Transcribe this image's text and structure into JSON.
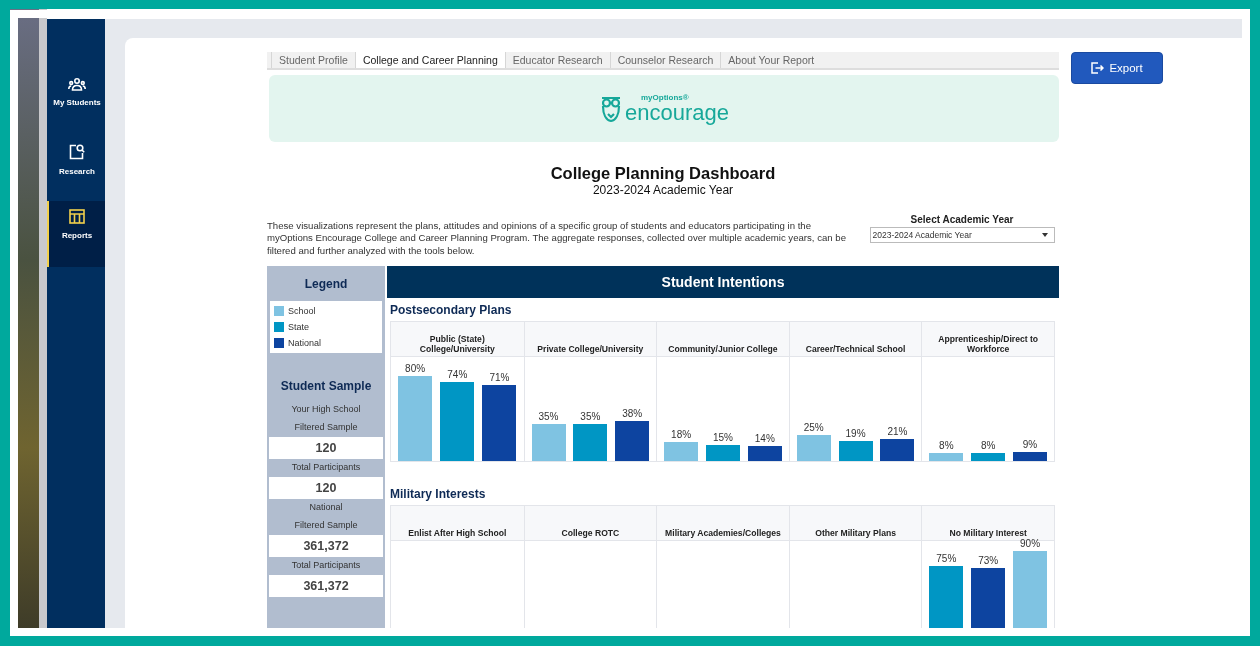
{
  "sidebar": {
    "items": [
      {
        "label": "My Students",
        "selected": false
      },
      {
        "label": "Research",
        "selected": false
      },
      {
        "label": "Reports",
        "selected": true
      }
    ]
  },
  "tabs": [
    {
      "label": "Student Profile",
      "selected": false
    },
    {
      "label": "College and Career Planning",
      "selected": true
    },
    {
      "label": "Educator Research",
      "selected": false
    },
    {
      "label": "Counselor Research",
      "selected": false
    },
    {
      "label": "About Your Report",
      "selected": false
    }
  ],
  "logo": {
    "superscript": "myOptions®",
    "wordmark": "encourage"
  },
  "export_button": {
    "label": "Export"
  },
  "title": "College Planning Dashboard",
  "subtitle": "2023-2024 Academic Year",
  "description": "These visualizations represent the plans, attitudes and opinions of a specific group of students and educators participating in the myOptions Encourage College and Career Planning Program. The aggregate responses, collected over multiple academic years, can be filtered and further analyzed with the tools below.",
  "year_select": {
    "label": "Select Academic Year",
    "value": "2023-2024 Academic Year"
  },
  "legend": {
    "title": "Legend",
    "items": [
      {
        "label": "School",
        "color": "#7fc3e2"
      },
      {
        "label": "State",
        "color": "#0096c4"
      },
      {
        "label": "National",
        "color": "#0d44a0"
      }
    ]
  },
  "student_sample": {
    "title": "Student Sample",
    "groups": [
      {
        "heading": "Your High School",
        "fields": [
          {
            "label": "Filtered Sample",
            "value": "120"
          },
          {
            "label": "Total Participants",
            "value": "120"
          }
        ]
      },
      {
        "heading": "National",
        "fields": [
          {
            "label": "Filtered Sample",
            "value": "361,372"
          },
          {
            "label": "Total Participants",
            "value": "361,372"
          }
        ]
      }
    ]
  },
  "panel_title": "Student Intentions",
  "sections": [
    {
      "title": "Postsecondary Plans",
      "chart_data": {
        "type": "bar",
        "categories": [
          "Public (State) College/University",
          "Private College/University",
          "Community/Junior College",
          "Career/Technical School",
          "Apprenticeship/Direct to Workforce"
        ],
        "series": [
          {
            "color": "#7fc3e2",
            "values": [
              80,
              35,
              18,
              25,
              8
            ],
            "value_labels": [
              "80%",
              "35%",
              "18%",
              "25%",
              "8%"
            ]
          },
          {
            "color": "#0096c4",
            "values": [
              74,
              35,
              15,
              19,
              8
            ],
            "value_labels": [
              "74%",
              "35%",
              "15%",
              "19%",
              "8%"
            ]
          },
          {
            "color": "#0d44a0",
            "values": [
              71,
              38,
              14,
              21,
              9
            ],
            "value_labels": [
              "71%",
              "38%",
              "14%",
              "21%",
              "9%"
            ]
          }
        ]
      }
    },
    {
      "title": "Military Interests",
      "chart_data": {
        "type": "bar",
        "categories": [
          "Enlist After High School",
          "College ROTC",
          "Military Academies/Colleges",
          "Other Military Plans",
          "No Military Interest"
        ],
        "series": [
          {
            "color": "#0096c4",
            "values": [
              null,
              null,
              null,
              null,
              75
            ],
            "value_labels": [
              null,
              null,
              null,
              null,
              "75%"
            ]
          },
          {
            "color": "#0d44a0",
            "values": [
              null,
              null,
              null,
              null,
              73
            ],
            "value_labels": [
              null,
              null,
              null,
              null,
              "73%"
            ]
          },
          {
            "color": "#7fc3e2",
            "values": [
              null,
              null,
              null,
              null,
              90
            ],
            "value_labels": [
              null,
              null,
              null,
              null,
              "90%"
            ]
          }
        ]
      }
    }
  ]
}
